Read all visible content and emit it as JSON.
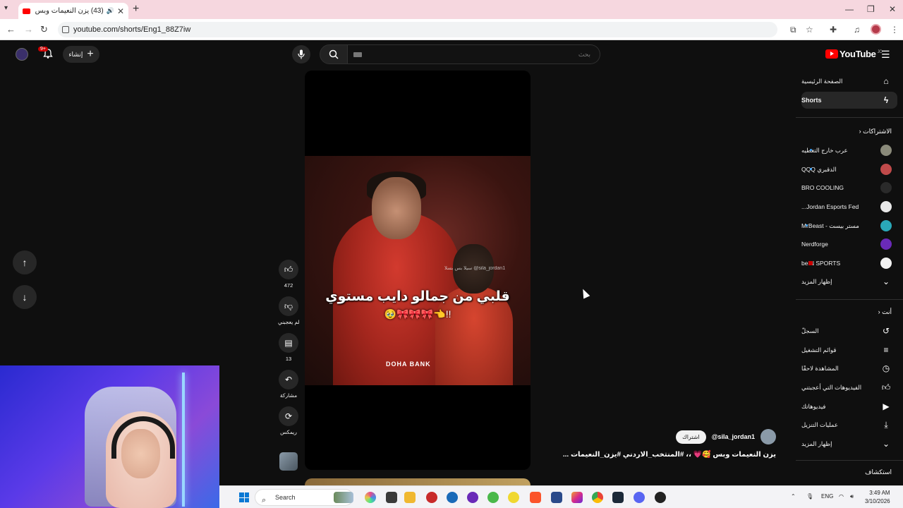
{
  "browser": {
    "tab_title": "(43) يزن النعيمات وبس 🥰💗",
    "url": "youtube.com/shorts/Eng1_88Z7iw"
  },
  "header": {
    "create_label": "إنشاء",
    "notification_count": "9+",
    "search_placeholder": "بحث",
    "logo_text": "YouTube",
    "logo_region": "JO"
  },
  "sidebar": {
    "main": [
      {
        "label": "الصفحة الرئيسية",
        "icon": "home-icon"
      },
      {
        "label": "Shorts",
        "icon": "shorts-icon",
        "active": true
      }
    ],
    "subscriptions_heading": "الاشتراكات",
    "subscriptions": [
      {
        "label": "عرب خارج التغطيه",
        "dot": true
      },
      {
        "label": "الدقبري QQQ",
        "dot": true
      },
      {
        "label": "BRO COOLING"
      },
      {
        "label": "Jordan Esports Fed..."
      },
      {
        "label": "مستر بيست - MrBeast",
        "dot": true
      },
      {
        "label": "Nerdforge"
      },
      {
        "label": "beIN SPORTS",
        "live": true
      }
    ],
    "subs_show_more": "إظهار المزيد",
    "you_heading": "أنت",
    "you_items": [
      {
        "label": "السجلّ",
        "icon": "history-icon"
      },
      {
        "label": "قوائم التشغيل",
        "icon": "playlists-icon"
      },
      {
        "label": "المشاهدة لاحقًا",
        "icon": "watch-later-icon"
      },
      {
        "label": "الفيديوهات التي أعجبتني",
        "icon": "liked-icon"
      },
      {
        "label": "فيديوهاتك",
        "icon": "your-videos-icon"
      },
      {
        "label": "عمليات التنزيل",
        "icon": "downloads-icon"
      }
    ],
    "you_show_more": "إظهار المزيد",
    "explore_heading": "استكشاف"
  },
  "short": {
    "caption_main": "قلبي من جمالو دايب مستوي",
    "caption_sub": "🥹🎀🎀🎀👈!!",
    "watermark": "سيلا بس بسلا\n@sila_jordan1",
    "sponsor_text": "DOHA BANK",
    "channel_handle": "@sila_jordan1",
    "subscribe_label": "اشتراك",
    "title": "يزن النعيمات وبس 🥰💗 ،، #المنتخب_الاردني #يزن_النعيمات ..."
  },
  "actions": {
    "like_count": "472",
    "dislike_label": "لم يعجبني",
    "comments_count": "13",
    "share_label": "مشاركة",
    "remix_label": "ريمكس"
  },
  "taskbar": {
    "search_label": "Search",
    "lang": "ENG",
    "time": "3:49 AM",
    "date": "3/10/2026"
  }
}
